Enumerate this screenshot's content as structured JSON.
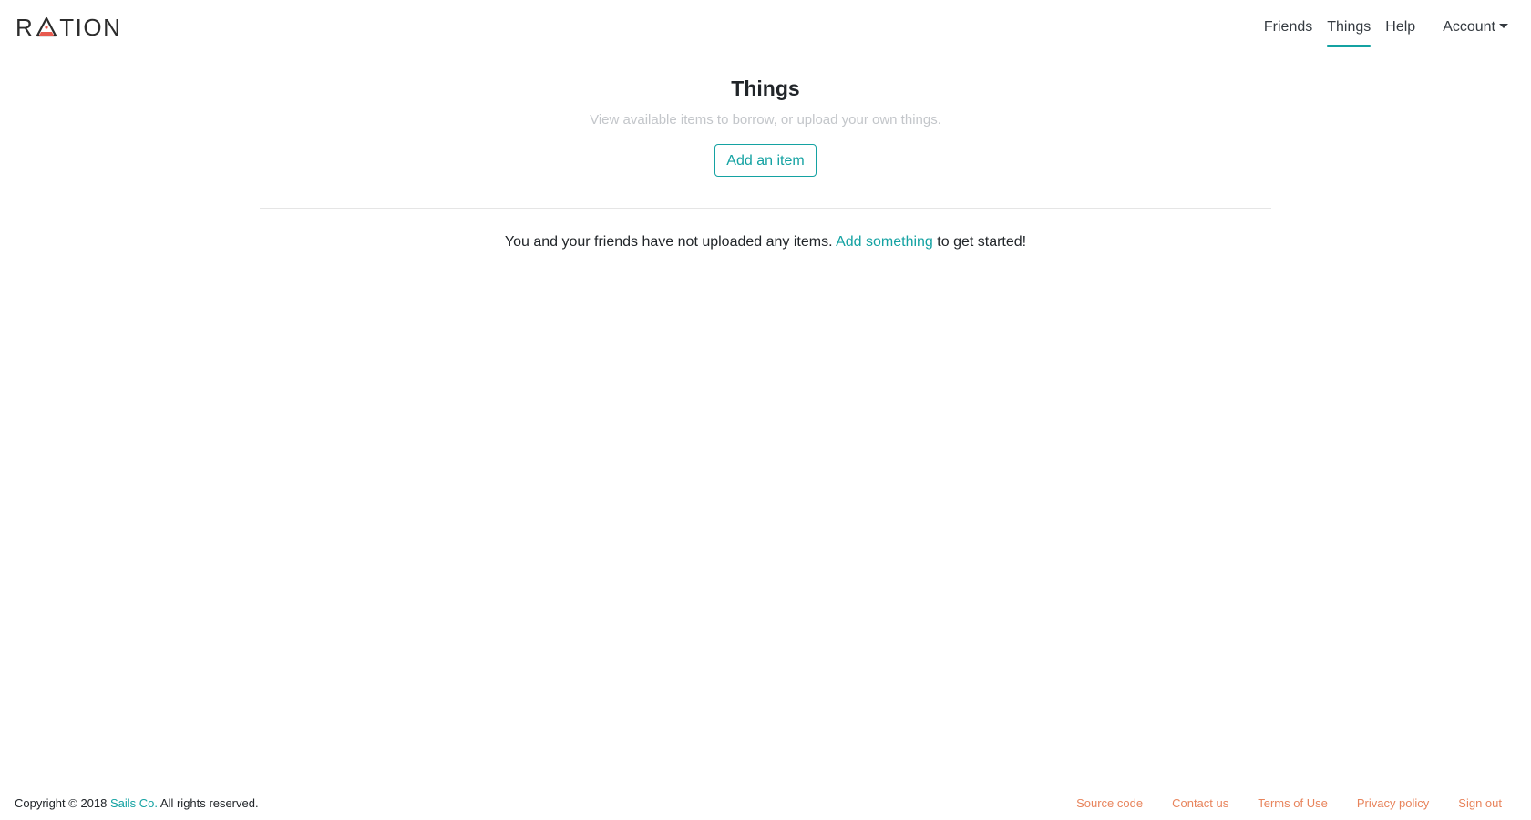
{
  "header": {
    "logo_text_before": "R",
    "logo_text_after": "TION",
    "nav": {
      "friends": "Friends",
      "things": "Things",
      "help": "Help",
      "account": "Account"
    }
  },
  "main": {
    "title": "Things",
    "subtitle": "View available items to borrow, or upload your own things.",
    "add_button": "Add an item",
    "empty_message_before": "You and your friends have not uploaded any items.",
    "empty_message_link": "Add something",
    "empty_message_after": "to get started!"
  },
  "footer": {
    "copyright_before": "Copyright © 2018",
    "copyright_link": "Sails Co.",
    "copyright_after": "All rights reserved.",
    "links": {
      "source_code": "Source code",
      "contact_us": "Contact us",
      "terms": "Terms of Use",
      "privacy": "Privacy policy",
      "sign_out": "Sign out"
    }
  },
  "colors": {
    "accent": "#14a2a2",
    "footer_link": "#e8845c",
    "logo_mark": "#e85a4f"
  }
}
